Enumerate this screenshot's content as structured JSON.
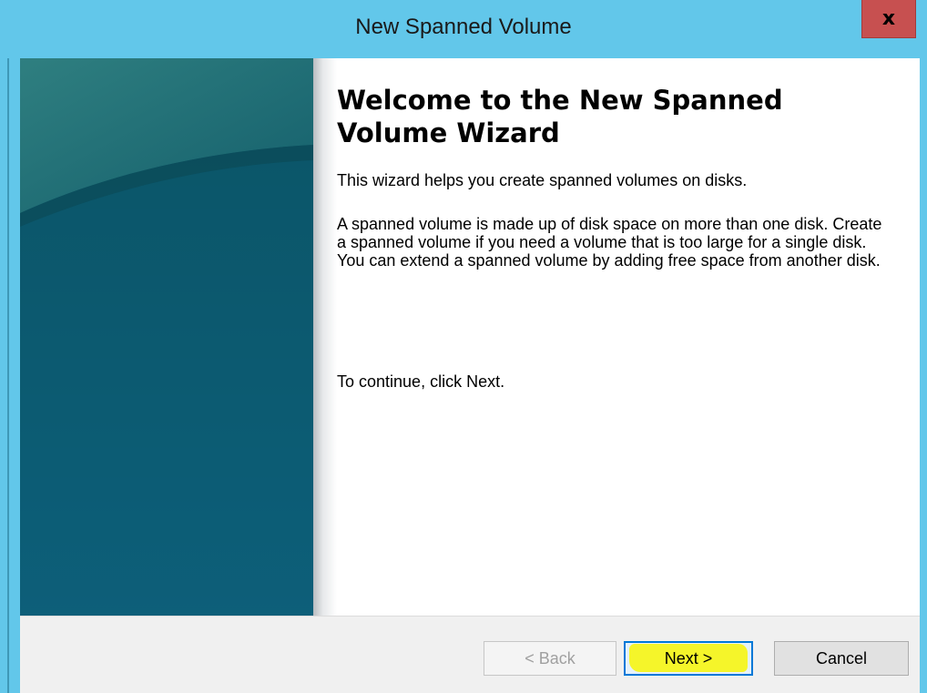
{
  "window": {
    "title": "New Spanned Volume",
    "close_glyph": "x"
  },
  "wizard": {
    "heading": "Welcome to the New Spanned Volume Wizard",
    "intro": "This wizard helps you create spanned volumes on disks.",
    "description": "A spanned volume is made up of disk space on more than one disk. Create a spanned volume if you need a volume that is too large for a single disk. You can extend a spanned volume by adding free space from another disk.",
    "instruction": "To continue, click Next."
  },
  "buttons": {
    "back": {
      "label": "< Back",
      "enabled": false
    },
    "next": {
      "label": "Next >",
      "highlighted": true
    },
    "cancel": {
      "label": "Cancel"
    }
  },
  "colors": {
    "titlebar": "#62c7ea",
    "close_button": "#c75050",
    "banner": "#0f5f74",
    "highlight": "#f5f52a"
  }
}
